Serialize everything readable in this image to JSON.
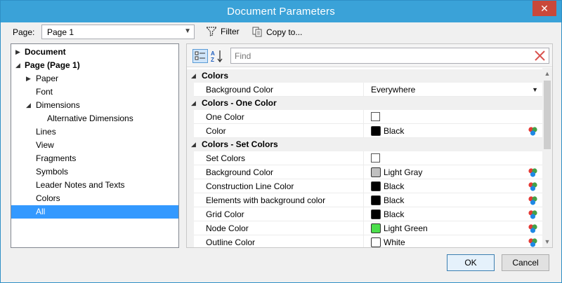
{
  "window": {
    "title": "Document Parameters",
    "close_glyph": "✕"
  },
  "toolbar": {
    "page_label": "Page:",
    "page_value": "Page 1",
    "filter_label": "Filter",
    "copy_label": "Copy to..."
  },
  "tree": {
    "items": [
      {
        "label": "Document",
        "level": 0,
        "bold": true,
        "arrow": "▶",
        "selected": false
      },
      {
        "label": "Page (Page 1)",
        "level": 0,
        "bold": true,
        "arrow": "◢",
        "selected": false
      },
      {
        "label": "Paper",
        "level": 1,
        "bold": false,
        "arrow": "▶",
        "selected": false
      },
      {
        "label": "Font",
        "level": 1,
        "bold": false,
        "arrow": "",
        "selected": false
      },
      {
        "label": "Dimensions",
        "level": 1,
        "bold": false,
        "arrow": "◢",
        "selected": false
      },
      {
        "label": "Alternative Dimensions",
        "level": 2,
        "bold": false,
        "arrow": "",
        "selected": false
      },
      {
        "label": "Lines",
        "level": 1,
        "bold": false,
        "arrow": "",
        "selected": false
      },
      {
        "label": "View",
        "level": 1,
        "bold": false,
        "arrow": "",
        "selected": false
      },
      {
        "label": "Fragments",
        "level": 1,
        "bold": false,
        "arrow": "",
        "selected": false
      },
      {
        "label": "Symbols",
        "level": 1,
        "bold": false,
        "arrow": "",
        "selected": false
      },
      {
        "label": "Leader Notes and Texts",
        "level": 1,
        "bold": false,
        "arrow": "",
        "selected": false
      },
      {
        "label": "Colors",
        "level": 1,
        "bold": false,
        "arrow": "",
        "selected": false
      },
      {
        "label": "All",
        "level": 1,
        "bold": false,
        "arrow": "",
        "selected": true
      }
    ]
  },
  "search": {
    "placeholder": "Find",
    "value": ""
  },
  "properties": {
    "categories": [
      {
        "label": "Colors",
        "arrow": "◢",
        "rows": [
          {
            "name": "Background Color",
            "kind": "dropdown",
            "value": "Everywhere"
          }
        ]
      },
      {
        "label": "Colors - One Color",
        "arrow": "◢",
        "rows": [
          {
            "name": "One Color",
            "kind": "checkbox",
            "checked": false
          },
          {
            "name": "Color",
            "kind": "color",
            "value": "Black",
            "swatch": "#000000"
          }
        ]
      },
      {
        "label": "Colors - Set Colors",
        "arrow": "◢",
        "rows": [
          {
            "name": "Set Colors",
            "kind": "checkbox",
            "checked": false
          },
          {
            "name": "Background Color",
            "kind": "color",
            "value": "Light Gray",
            "swatch": "#c0c0c0"
          },
          {
            "name": "Construction Line Color",
            "kind": "color",
            "value": "Black",
            "swatch": "#000000"
          },
          {
            "name": "Elements with background color",
            "kind": "color",
            "value": "Black",
            "swatch": "#000000"
          },
          {
            "name": "Grid Color",
            "kind": "color",
            "value": "Black",
            "swatch": "#000000"
          },
          {
            "name": "Node Color",
            "kind": "color",
            "value": "Light Green",
            "swatch": "#4cdf4c"
          },
          {
            "name": "Outline Color",
            "kind": "color",
            "value": "White",
            "swatch": "#ffffff"
          }
        ]
      }
    ]
  },
  "footer": {
    "ok_label": "OK",
    "cancel_label": "Cancel"
  },
  "colors": {
    "titlebar": "#3aa2d8",
    "selection": "#3399ff",
    "close": "#c9483a"
  }
}
